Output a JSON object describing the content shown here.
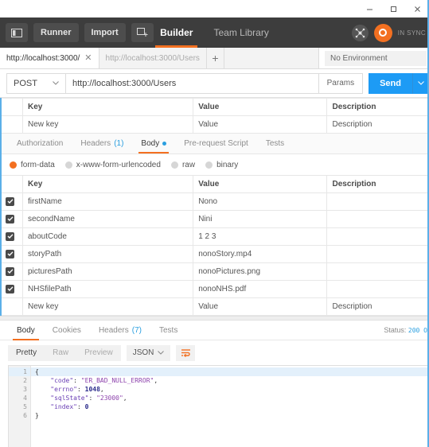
{
  "window": {
    "controls": [
      {
        "name": "minimize",
        "glyph": "minimize-icon"
      },
      {
        "name": "maximize",
        "glyph": "maximize-icon"
      },
      {
        "name": "close",
        "glyph": "close-icon"
      }
    ]
  },
  "toolbar": {
    "sidebar_toggle_icon": "sidebar-toggle-icon",
    "runner_label": "Runner",
    "import_label": "Import",
    "new_tab_icon": "new-window-icon",
    "tabs": [
      {
        "label": "Builder",
        "active": true
      },
      {
        "label": "Team Library",
        "active": false
      }
    ],
    "settings_icon": "network-icon",
    "avatar_icon": "user-avatar-icon",
    "sync_status": "IN SYNC"
  },
  "tabstrip": {
    "tabs": [
      {
        "label": "http://localhost:3000/",
        "active": true,
        "close_icon": "close-icon"
      },
      {
        "label": "http://localhost:3000/Users",
        "active": false
      }
    ],
    "new_tab_label": "+",
    "environment": "No Environment"
  },
  "request": {
    "method": "POST",
    "method_caret": "chevron-down-icon",
    "url": "http://localhost:3000/Users",
    "params_label": "Params",
    "send_label": "Send",
    "send_caret": "chevron-down-icon"
  },
  "headers_table": {
    "columns": [
      "Key",
      "Value",
      "Description"
    ],
    "placeholder_row": {
      "key": "New key",
      "value": "Value",
      "description": "Description"
    }
  },
  "request_tabs": [
    {
      "label": "Authorization",
      "active": false
    },
    {
      "label": "Headers",
      "count": "(1)",
      "active": false
    },
    {
      "label": "Body",
      "active": true,
      "dot": true
    },
    {
      "label": "Pre-request Script",
      "active": false
    },
    {
      "label": "Tests",
      "active": false
    }
  ],
  "body_type": {
    "options": [
      {
        "label": "form-data",
        "selected": true
      },
      {
        "label": "x-www-form-urlencoded",
        "selected": false
      },
      {
        "label": "raw",
        "selected": false
      },
      {
        "label": "binary",
        "selected": false
      }
    ]
  },
  "form_data": {
    "columns": [
      "Key",
      "Value",
      "Description"
    ],
    "rows": [
      {
        "checked": true,
        "key": "firstName",
        "value": "Nono",
        "description": ""
      },
      {
        "checked": true,
        "key": "secondName",
        "value": "Nini",
        "description": ""
      },
      {
        "checked": true,
        "key": "aboutCode",
        "value": "1 2 3",
        "description": ""
      },
      {
        "checked": true,
        "key": "storyPath",
        "value": "nonoStory.mp4",
        "description": ""
      },
      {
        "checked": true,
        "key": "picturesPath",
        "value": "nonoPictures.png",
        "description": ""
      },
      {
        "checked": true,
        "key": "NHSfilePath",
        "value": "nonoNHS.pdf",
        "description": ""
      }
    ],
    "placeholder_row": {
      "key": "New key",
      "value": "Value",
      "description": "Description"
    }
  },
  "response_tabs": [
    {
      "label": "Body",
      "active": true
    },
    {
      "label": "Cookies",
      "active": false
    },
    {
      "label": "Headers",
      "count": "(7)",
      "active": false
    },
    {
      "label": "Tests",
      "active": false
    }
  ],
  "response_status": {
    "label": "Status:",
    "code": "200 O"
  },
  "response_viewbar": {
    "views": [
      {
        "label": "Pretty",
        "active": true
      },
      {
        "label": "Raw",
        "active": false
      },
      {
        "label": "Preview",
        "active": false
      }
    ],
    "format": "JSON",
    "format_caret": "chevron-down-icon",
    "wrap_icon": "wrap-lines-icon"
  },
  "response_body": {
    "line_numbers": [
      "1",
      "2",
      "3",
      "4",
      "5",
      "6"
    ],
    "fold_marker": "▾",
    "lines": [
      {
        "segments": [
          {
            "t": "{",
            "c": "p"
          }
        ],
        "highlight": true
      },
      {
        "segments": [
          {
            "t": "    ",
            "c": "p"
          },
          {
            "t": "\"code\"",
            "c": "k"
          },
          {
            "t": ": ",
            "c": "p"
          },
          {
            "t": "\"ER_BAD_NULL_ERROR\"",
            "c": "s"
          },
          {
            "t": ",",
            "c": "p"
          }
        ]
      },
      {
        "segments": [
          {
            "t": "    ",
            "c": "p"
          },
          {
            "t": "\"errno\"",
            "c": "k"
          },
          {
            "t": ": ",
            "c": "p"
          },
          {
            "t": "1048",
            "c": "n"
          },
          {
            "t": ",",
            "c": "p"
          }
        ]
      },
      {
        "segments": [
          {
            "t": "    ",
            "c": "p"
          },
          {
            "t": "\"sqlState\"",
            "c": "k"
          },
          {
            "t": ": ",
            "c": "p"
          },
          {
            "t": "\"23000\"",
            "c": "s"
          },
          {
            "t": ",",
            "c": "p"
          }
        ]
      },
      {
        "segments": [
          {
            "t": "    ",
            "c": "p"
          },
          {
            "t": "\"index\"",
            "c": "k"
          },
          {
            "t": ": ",
            "c": "p"
          },
          {
            "t": "0",
            "c": "n"
          }
        ]
      },
      {
        "segments": [
          {
            "t": "}",
            "c": "p"
          }
        ]
      }
    ]
  },
  "colors": {
    "accent_orange": "#f37021",
    "accent_blue": "#1d9bf5",
    "toolbar_dark": "#3d3d3d"
  }
}
